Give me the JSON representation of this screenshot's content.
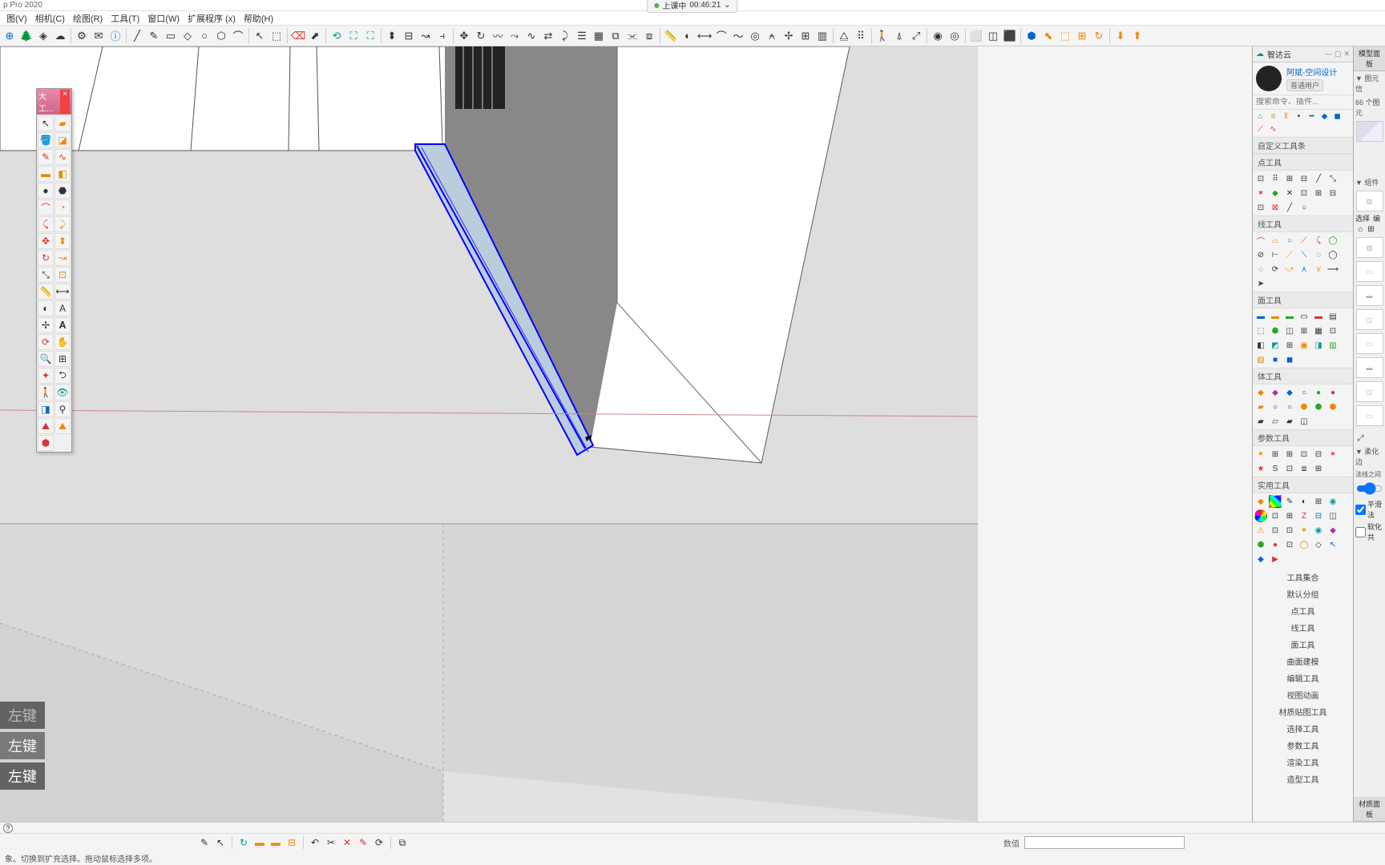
{
  "app_title": "p Pro 2020",
  "recording": {
    "label": "上课中",
    "time": "00:46:21"
  },
  "menu": [
    "图(V)",
    "相机(C)",
    "绘图(R)",
    "工具(T)",
    "窗口(W)",
    "扩展程序 (x)",
    "帮助(H)"
  ],
  "floating_toolbox_title": "大工...",
  "key_overlay": [
    "左键",
    "左键",
    "左键"
  ],
  "plugin_panel": {
    "title": "智达云",
    "user_name": "阿斌-空间设计",
    "user_tag": "普通用户",
    "search_placeholder": "搜索命令、插件...",
    "custom_label": "自定义工具条",
    "sections": {
      "point": "点工具",
      "line": "线工具",
      "face": "面工具",
      "body": "体工具",
      "param": "参数工具",
      "util": "实用工具"
    },
    "tree": [
      "工具集合",
      "默认分组",
      "点工具",
      "线工具",
      "面工具",
      "曲面建模",
      "编辑工具",
      "视图动画",
      "材质贴图工具",
      "选择工具",
      "参数工具",
      "渲染工具",
      "造型工具"
    ]
  },
  "far_panel": {
    "title": "模型面板",
    "sub1": "▼ 图元信",
    "count": "66 个图元",
    "comp": "▼ 组件",
    "sel_label": "选择",
    "edit_label": "编",
    "soften_title": "▼ 柔化边",
    "soften_sub": "法线之间",
    "cb1": "平滑法",
    "cb2": "软化共",
    "mat": "材质面板"
  },
  "status": {
    "hint": "象。切换到扩充选择。拖动鼠标选择多项。",
    "value_label": "数值"
  }
}
